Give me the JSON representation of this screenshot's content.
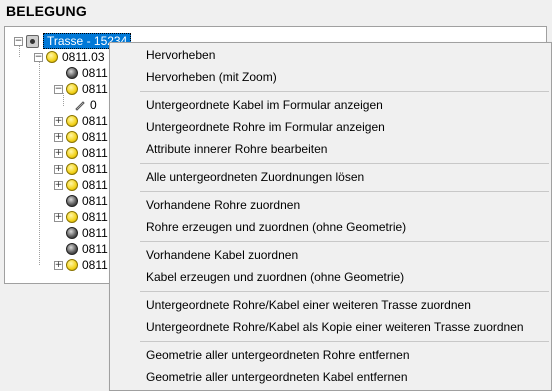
{
  "panel": {
    "title": "BELEGUNG"
  },
  "tree": {
    "root": {
      "label": "Trasse - 15234",
      "expander": "⊟"
    },
    "node": {
      "label": "0811.03",
      "expander": "⊟"
    },
    "children": [
      {
        "label": "0811",
        "icon": "dark",
        "expander": ""
      },
      {
        "label": "0811",
        "icon": "yellow",
        "expander": "−"
      },
      {
        "label": "0",
        "icon": "pen",
        "expander": ""
      },
      {
        "label": "0811",
        "icon": "yellow",
        "expander": "+"
      },
      {
        "label": "0811",
        "icon": "yellow",
        "expander": "+"
      },
      {
        "label": "0811",
        "icon": "yellow",
        "expander": "+"
      },
      {
        "label": "0811",
        "icon": "yellow",
        "expander": "+"
      },
      {
        "label": "0811",
        "icon": "yellow",
        "expander": "+"
      },
      {
        "label": "0811",
        "icon": "dark",
        "expander": ""
      },
      {
        "label": "0811",
        "icon": "yellow",
        "expander": "+"
      },
      {
        "label": "0811",
        "icon": "dark",
        "expander": ""
      },
      {
        "label": "0811",
        "icon": "dark",
        "expander": ""
      },
      {
        "label": "0811",
        "icon": "yellow",
        "expander": "+"
      }
    ]
  },
  "context_menu": {
    "items": [
      "Hervorheben",
      "Hervorheben (mit Zoom)",
      "Untergeordnete Kabel im Formular anzeigen",
      "Untergeordnete Rohre im Formular anzeigen",
      "Attribute innerer Rohre bearbeiten",
      "Alle untergeordneten Zuordnungen lösen",
      "Vorhandene Rohre zuordnen",
      "Rohre erzeugen und zuordnen (ohne Geometrie)",
      "Vorhandene Kabel zuordnen",
      "Kabel erzeugen und zuordnen (ohne Geometrie)",
      "Untergeordnete Rohre/Kabel einer weiteren Trasse zuordnen",
      "Untergeordnete Rohre/Kabel als Kopie einer weiteren Trasse zuordnen",
      "Geometrie aller untergeordneten Rohre entfernen",
      "Geometrie aller untergeordneten Kabel entfernen"
    ]
  },
  "colors": {
    "selection": "#0078d7",
    "menu_bg": "#f0f0f0",
    "panel_border": "#a0a0a0"
  }
}
